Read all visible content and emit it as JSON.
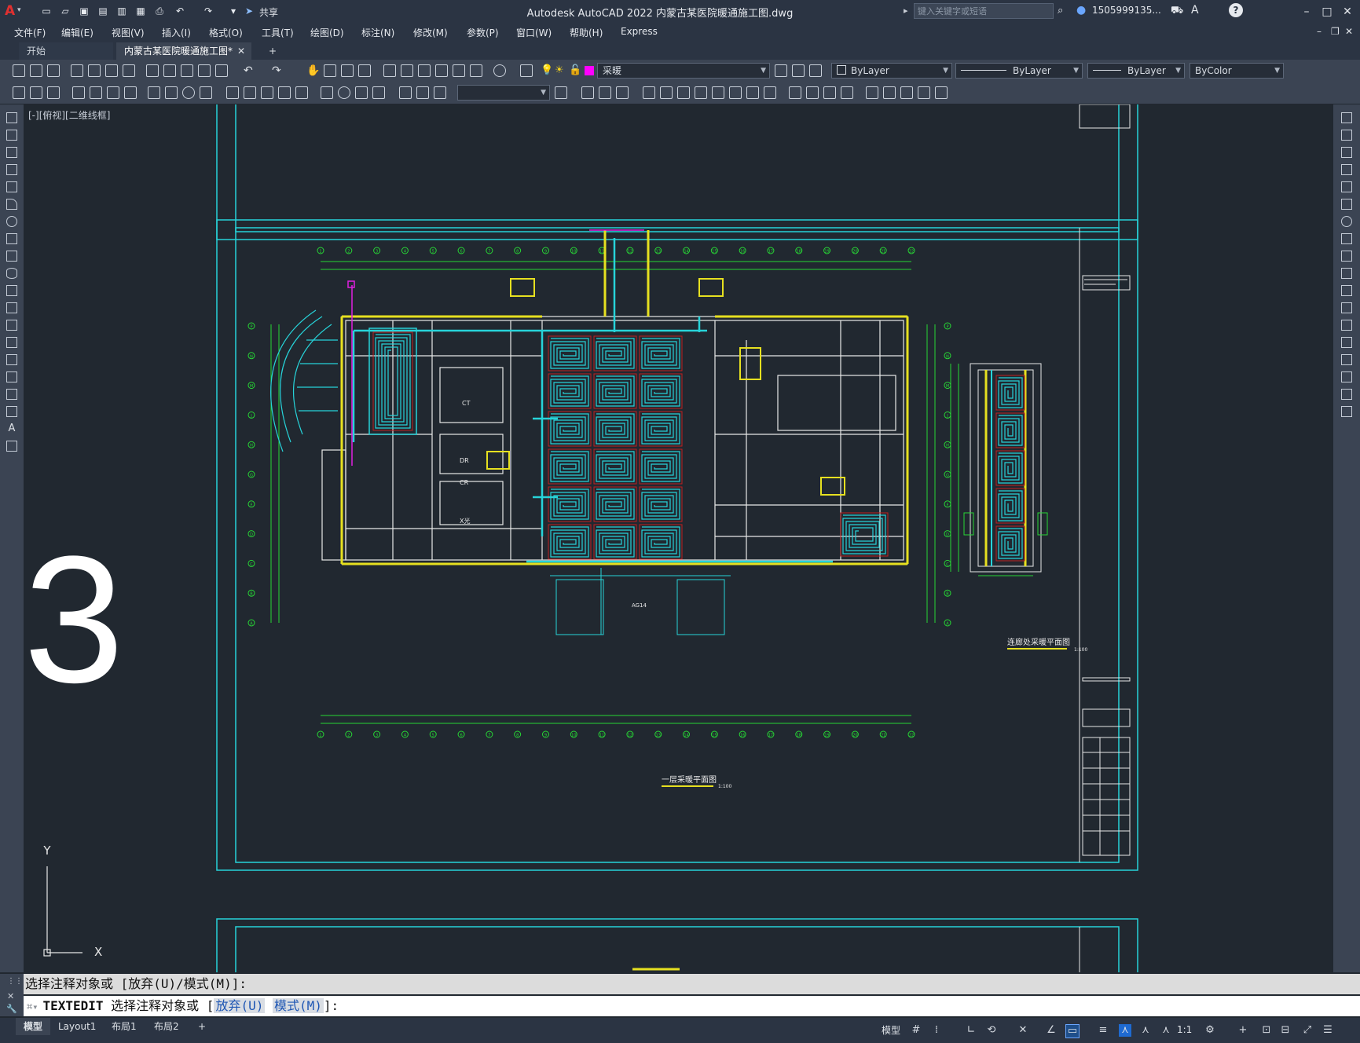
{
  "app": {
    "title": "Autodesk AutoCAD 2022    内蒙古某医院暖通施工图.dwg",
    "logo": "A",
    "share_label": "共享",
    "search_placeholder": "键入关键字或短语",
    "user": "1505999135...",
    "help": "?"
  },
  "menu": [
    "文件(F)",
    "编辑(E)",
    "视图(V)",
    "插入(I)",
    "格式(O)",
    "工具(T)",
    "绘图(D)",
    "标注(N)",
    "修改(M)",
    "参数(P)",
    "窗口(W)",
    "帮助(H)",
    "Express"
  ],
  "tabs": {
    "start": "开始",
    "active": "内蒙古某医院暖通施工图*",
    "add": "+"
  },
  "toolbar": {
    "layer": "采暖",
    "color": "ByLayer",
    "linetype": "ByLayer",
    "lineweight": "ByLayer",
    "plotstyle": "ByColor",
    "layer_color": "#ff00ff"
  },
  "viewport": {
    "label": "[-][俯视][二维线框]",
    "big_number": "3",
    "ucs_x": "X",
    "ucs_y": "Y"
  },
  "drawing": {
    "plan_title": "一层采暖平面图",
    "plan_scale": "1:100",
    "corridor_title": "连廊处采暖平面图",
    "corridor_scale": "1:100",
    "room_labels": [
      "CT",
      "DR",
      "CR",
      "X光",
      "AG14",
      "采暖"
    ],
    "grid_top": [
      "1",
      "2",
      "3",
      "4",
      "5",
      "6",
      "7",
      "8",
      "9",
      "10",
      "11",
      "12",
      "13",
      "14",
      "15",
      "16",
      "17",
      "18",
      "19",
      "20",
      "21",
      "22"
    ],
    "grid_left": [
      "P",
      "N",
      "M",
      "J",
      "H",
      "G",
      "F",
      "D",
      "C",
      "B",
      "A"
    ]
  },
  "command": {
    "history": "选择注释对象或 [放弃(U)/模式(M)]:",
    "cmd": "TEXTEDIT",
    "prompt_pre": "选择注释对象或 [",
    "opt1": "放弃(U)",
    "opt2": "模式(M)",
    "prompt_post": "]:"
  },
  "status": {
    "tabs": [
      "模型",
      "Layout1",
      "布局1",
      "布局2"
    ],
    "model_button": "模型",
    "scale": "1:1"
  },
  "colors": {
    "cyan": "#27d3d9",
    "yellow": "#e6e020",
    "green": "#27d635",
    "white": "#e8e8e8",
    "magenta": "#e020e0"
  }
}
